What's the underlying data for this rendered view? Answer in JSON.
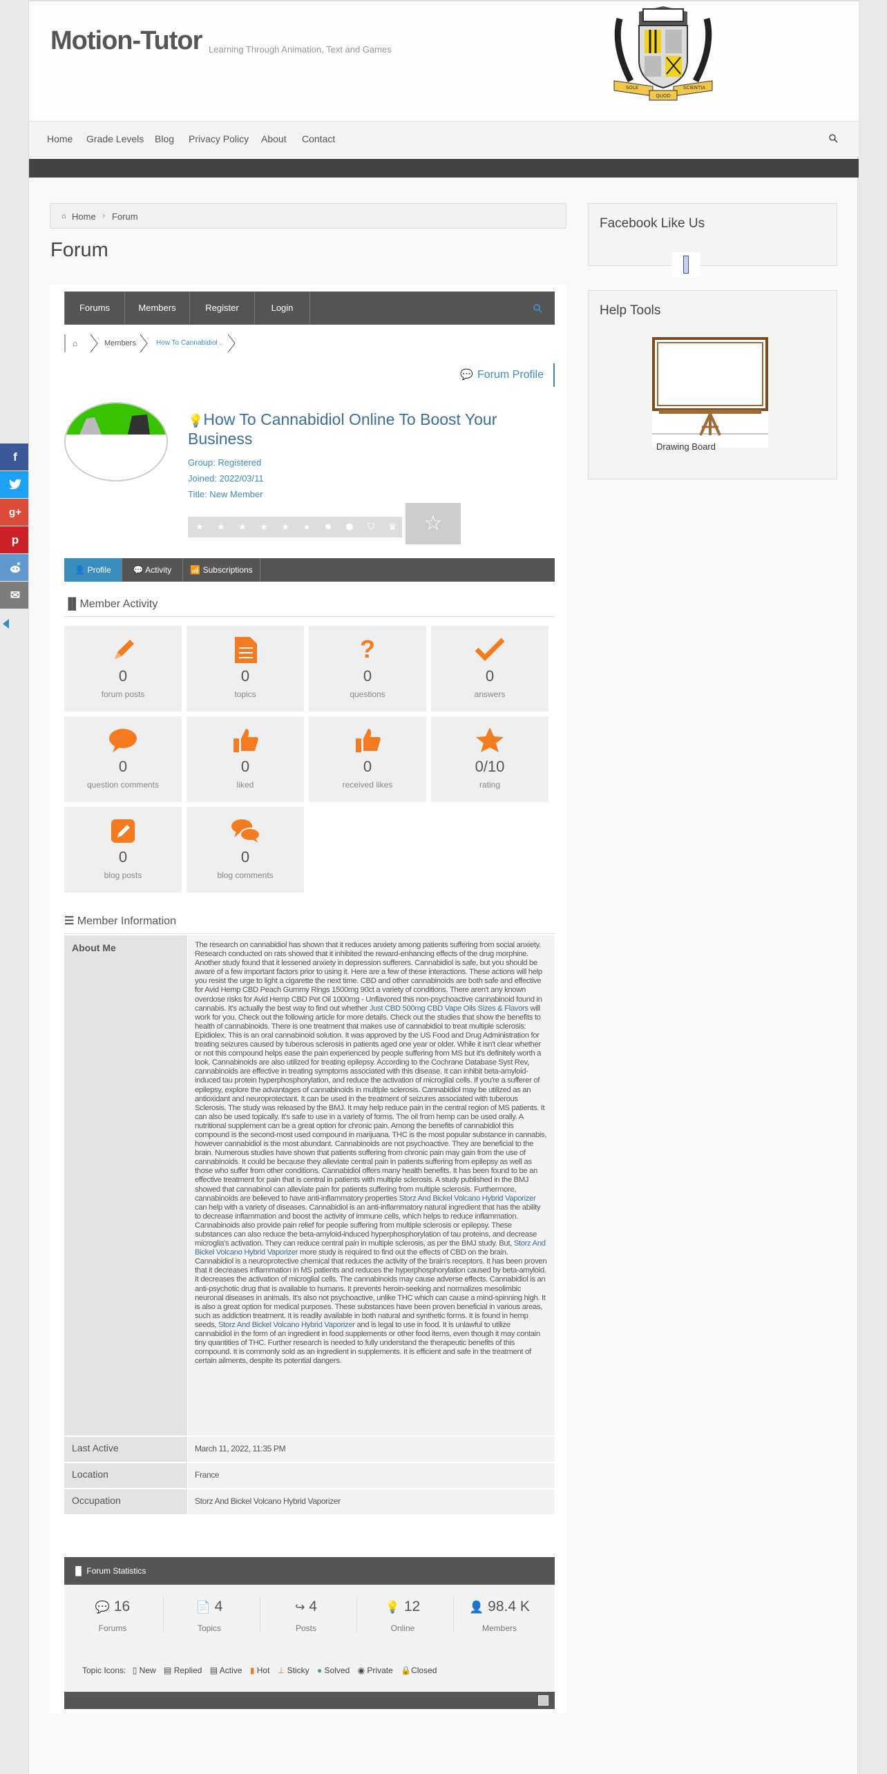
{
  "site": {
    "title": "Motion-Tutor",
    "tagline": "Learning Through Animation, Text and Games",
    "logo_words": [
      "SOLE",
      "SCIENTIA",
      "QUOD"
    ]
  },
  "nav": {
    "items": [
      "Home",
      "Grade Levels",
      "Blog",
      "Privacy Policy",
      "About",
      "Contact"
    ]
  },
  "breadcrumb": {
    "home": "Home",
    "current": "Forum"
  },
  "page_title": "Forum",
  "forum_bar": {
    "items": [
      "Forums",
      "Members",
      "Register",
      "Login"
    ]
  },
  "forum_crumbs": {
    "members": "Members",
    "current": "How To Cannabidiol ..."
  },
  "forum_profile": "Forum Profile",
  "profile": {
    "title": "How To Cannabidiol Online To Boost Your Business",
    "group": "Group: Registered",
    "joined": "Joined: 2022/03/11",
    "title_line": "Title: New Member"
  },
  "tabs": [
    "Profile",
    "Activity",
    "Subscriptions"
  ],
  "activity_title": "Member Activity",
  "stats": [
    {
      "icon": "pencil-icon",
      "value": "0",
      "label": "forum posts"
    },
    {
      "icon": "document-icon",
      "value": "0",
      "label": "topics"
    },
    {
      "icon": "question-icon",
      "value": "0",
      "label": "questions"
    },
    {
      "icon": "checkmark-icon",
      "value": "0",
      "label": "answers"
    },
    {
      "icon": "comment-icon",
      "value": "0",
      "label": "question comments"
    },
    {
      "icon": "thumbs-up-icon",
      "value": "0",
      "label": "liked"
    },
    {
      "icon": "received-like-icon",
      "value": "0",
      "label": "received likes"
    },
    {
      "icon": "star-icon",
      "value": "0/10",
      "label": "rating"
    },
    {
      "icon": "edit-icon",
      "value": "0",
      "label": "blog posts"
    },
    {
      "icon": "comments-icon",
      "value": "0",
      "label": "blog comments"
    }
  ],
  "info_title": "Member Information",
  "info": {
    "about_label": "About Me",
    "about_parts": [
      "The research on cannabidiol has shown that it reduces anxiety among patients suffering from social anxiety. Research conducted on rats showed that it inhibited the reward-enhancing effects of the drug morphine. Another study found that it lessened anxiety in depression sufferers. Cannabidiol is safe, but you should be aware of a few important factors prior to using it. Here are a few of these interactions. These actions will help you resist the urge to light a cigarette the next time.  CBD and other cannabinoids are both safe and effective for Avid Hemp CBD Peach Gummy Rings 1500mg 90ct a variety of conditions. There aren't any known overdose risks for Avid Hemp CBD Pet Oil 1000mg - Unflavored this non-psychoactive cannabinoid found in cannabis. It's actually the best way to find out whether ",
      "Just CBD 500mg CBD Vape Oils Sizes & Flavors",
      " will work for you. Check out the following article for more details. Check out the studies that show the benefits to health of cannabinoids.  There is one treatment that makes use of cannabidiol to treat multiple sclerosis: Epidiolex. This is an oral cannabinoid solution. It was approved by the US Food and Drug Administration for treating seizures caused by tuberous sclerosis in patients aged one year or older. While it isn't clear whether or not this compound helps ease the pain experienced by people suffering from MS but it's definitely worth a look.  Cannabinoids are also utilized for treating epilepsy. According to the Cochrane Database Syst Rev, cannabinoids are effective in treating symptoms associated with this disease. It can inhibit beta-amyloid-induced tau protein hyperphosphorylation, and reduce the activation of microglial cells. If you're a sufferer of epilepsy, explore the advantages of cannabinoids in multiple sclerosis.  Cannabidiol may be utilized as an antioxidant and neuroprotectant. It can be used in the treatment of seizures associated with tuberous Sclerosis. The study was released by the BMJ. It may help reduce pain in the central region of MS patients. It can also be used topically. It's safe to use in a variety of forms. The oil from hemp can be used orally. A nutritional supplement can be a great option for chronic pain.  Among the benefits of cannabidiol this compound is the second-most used compound in marijuana. THC is the most popular substance in cannabis, however cannabidiol is the most abundant. Cannabinoids are not psychoactive. They are beneficial to the brain. Numerous studies have shown that patients suffering from chronic pain may gain from the use of cannabinoids. It could be because they alleviate central pain in patients suffering from epilepsy as well as those who suffer from other conditions.  Cannabidiol offers many health benefits. It has been found to be an effective treatment for pain that is central in patients with multiple sclerosis. A study published in the BMJ showed that cannabinol can alleviate pain for patients suffering from multiple sclerosis. Furthermore, cannabinoids are believed to have anti-inflammatory properties ",
      "Storz And Bickel Volcano Hybrid Vaporizer",
      " can help with a variety of diseases. Cannabidiol is an anti-inflammatory natural ingredient that has the ability to decrease inflammation and boost the activity of immune cells, which helps to reduce inflammation.  Cannabinoids also provide pain relief for people suffering from multiple sclerosis or epilepsy. These substances can also reduce the beta-amyloid-induced hyperphosphorylation of tau proteins, and decrease microglia's activation. They can reduce central pain in multiple sclerosis, as per the BMJ study. But, ",
      "Storz And Bickel Volcano Hybrid Vaporizer",
      " more study is required to find out the effects of CBD on the brain.  Cannabidiol is a neuroprotective chemical that reduces the activity of the brain's receptors. It has been proven that it decreases inflammation in MS patients and reduces the hyperphosphorylation caused by beta-amyloid. It decreases the activation of microglial cells. The cannabinoids may cause adverse effects.  Cannabidiol is an anti-psychotic drug that is available to humans. It prevents heroin-seeking and normalizes mesolimbic neuronal diseases in animals. It's also not psychoactive, unlike THC which can cause a mind-spinning high. It is also a great option for medical purposes. These substances have been proven beneficial in various areas, such as addiction treatment.  It is readily available in both natural and synthetic forms. It is found in hemp seeds, ",
      "Storz And Bickel Volcano Hybrid Vaporizer",
      " and is legal to use in food. It is unlawful to utilize cannabidiol in the form of an ingredient in food supplements or other food items, even though it may contain tiny quantities of THC. Further research is needed to fully understand the therapeutic benefits of this compound. It is commonly sold as an ingredient in supplements. It is efficient and safe in the treatment of certain ailments, despite its potential dangers."
    ],
    "last_active_label": "Last Active",
    "last_active": "March 11, 2022, 11:35 PM",
    "location_label": "Location",
    "location": "France",
    "occupation_label": "Occupation",
    "occupation": "Storz And Bickel Volcano Hybrid Vaporizer"
  },
  "forum_stats": {
    "title": "Forum Statistics",
    "items": [
      {
        "value": "16",
        "label": "Forums"
      },
      {
        "value": "4",
        "label": "Topics"
      },
      {
        "value": "4",
        "label": "Posts"
      },
      {
        "value": "12",
        "label": "Online"
      },
      {
        "value": "98.4 K",
        "label": "Members"
      }
    ],
    "topic_icons_label": "Topic Icons:",
    "topic_icons": [
      "New",
      "Replied",
      "Active",
      "Hot",
      "Sticky",
      "Solved",
      "Private",
      "Closed"
    ]
  },
  "sidebar": {
    "facebook_title": "Facebook Like Us",
    "help_title": "Help Tools",
    "drawing_board": "Drawing Board"
  },
  "share": {
    "colors": [
      "#3b5998",
      "#1da1f2",
      "#dd4b39",
      "#cb2027",
      "#5f99cf",
      "#7d7d7d"
    ],
    "icons": [
      "f",
      "t",
      "g+",
      "p",
      "r",
      "✉"
    ]
  },
  "colors": {
    "accent": "#3b8dbd",
    "orange": "#f47b20",
    "dark_bar": "#555555"
  }
}
